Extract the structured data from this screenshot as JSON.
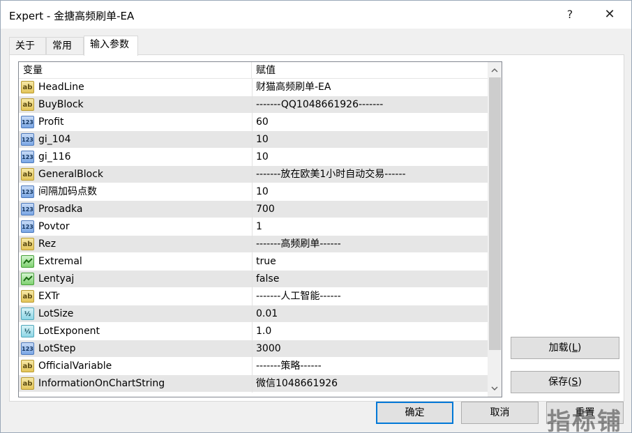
{
  "window": {
    "title": "Expert - 金搪高频刷单-EA",
    "help_label": "?",
    "close_label": "✕"
  },
  "tabs": [
    {
      "label": "关于",
      "active": false
    },
    {
      "label": "常用",
      "active": false
    },
    {
      "label": "输入参数",
      "active": true
    }
  ],
  "grid": {
    "header_variable": "变量",
    "header_value": "赋值",
    "rows": [
      {
        "type": "string",
        "name": "HeadLine",
        "value": "财猫高频刷单-EA"
      },
      {
        "type": "string",
        "name": "BuyBlock",
        "value": "-------QQ1048661926-------"
      },
      {
        "type": "int",
        "name": "Profit",
        "value": "60"
      },
      {
        "type": "int",
        "name": "gi_104",
        "value": "10"
      },
      {
        "type": "int",
        "name": "gi_116",
        "value": "10"
      },
      {
        "type": "string",
        "name": "GeneralBlock",
        "value": "-------放在欧美1小时自动交易------"
      },
      {
        "type": "int",
        "name": "间隔加码点数",
        "value": "10"
      },
      {
        "type": "int",
        "name": "Prosadka",
        "value": "700"
      },
      {
        "type": "int",
        "name": "Povtor",
        "value": "1"
      },
      {
        "type": "string",
        "name": "Rez",
        "value": "-------高频刷单------"
      },
      {
        "type": "bool",
        "name": "Extremal",
        "value": "true"
      },
      {
        "type": "bool",
        "name": "Lentyaj",
        "value": "false"
      },
      {
        "type": "string",
        "name": "EXTr",
        "value": "-------人工智能------"
      },
      {
        "type": "double",
        "name": "LotSize",
        "value": "0.01"
      },
      {
        "type": "double",
        "name": "LotExponent",
        "value": "1.0"
      },
      {
        "type": "int",
        "name": "LotStep",
        "value": "3000"
      },
      {
        "type": "string",
        "name": "OfficialVariable",
        "value": "-------策略------"
      },
      {
        "type": "string",
        "name": "InformationOnChartString",
        "value": "微信1048661926"
      }
    ]
  },
  "icon_labels": {
    "string": "ab",
    "int": "123",
    "double": "½",
    "bool": ""
  },
  "scrollbar": {
    "up_icon": "chevron-up-icon",
    "down_icon": "chevron-down-icon"
  },
  "buttons": {
    "load_text": "加载(",
    "load_key": "L",
    "load_suffix": ")",
    "save_text": "保存(",
    "save_key": "S",
    "save_suffix": ")",
    "ok": "确定",
    "cancel": "取消",
    "reset": "重置"
  },
  "watermark": "指标铺"
}
